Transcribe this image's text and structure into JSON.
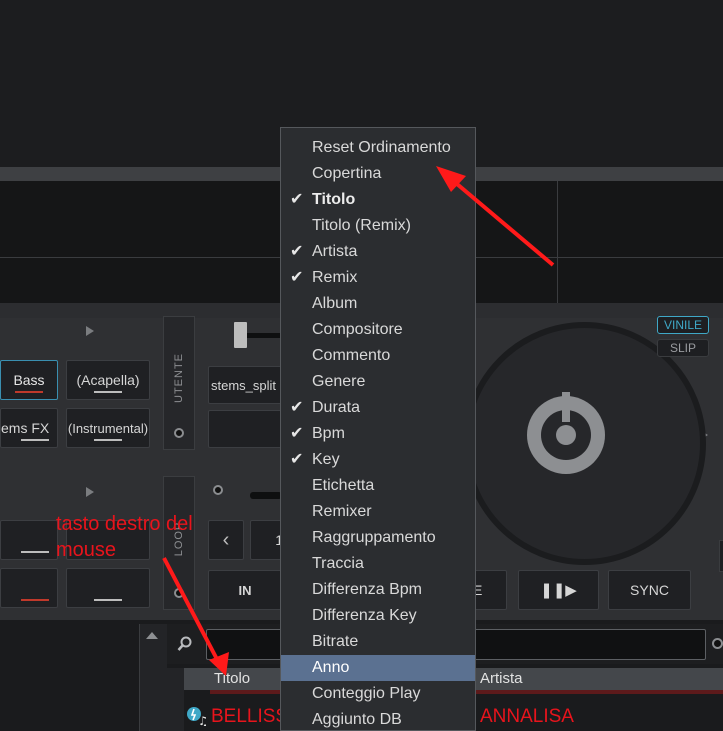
{
  "deck": {
    "pads_row1": [
      "Bass",
      "(Acapella)"
    ],
    "pads_row2": [
      "ems FX",
      "(Instrumental)"
    ],
    "user_label": "UTENTE",
    "loop_label": "LOOP",
    "stems_label": "stems_split",
    "vinyl_label": "VINILE",
    "slip_label": "SLIP",
    "in_label": "IN",
    "sync_label": "SYNC",
    "partial_digit": "1",
    "partial_letter": "E"
  },
  "context_menu": {
    "items": [
      {
        "label": "Reset Ordinamento",
        "checked": false
      },
      {
        "label": "Copertina",
        "checked": false
      },
      {
        "label": "Titolo",
        "checked": true,
        "bold": true
      },
      {
        "label": "Titolo (Remix)",
        "checked": false
      },
      {
        "label": "Artista",
        "checked": true
      },
      {
        "label": "Remix",
        "checked": true
      },
      {
        "label": "Album",
        "checked": false
      },
      {
        "label": "Compositore",
        "checked": false
      },
      {
        "label": "Commento",
        "checked": false
      },
      {
        "label": "Genere",
        "checked": false
      },
      {
        "label": "Durata",
        "checked": true
      },
      {
        "label": "Bpm",
        "checked": true
      },
      {
        "label": "Key",
        "checked": true
      },
      {
        "label": "Etichetta",
        "checked": false
      },
      {
        "label": "Remixer",
        "checked": false
      },
      {
        "label": "Raggruppamento",
        "checked": false
      },
      {
        "label": "Traccia",
        "checked": false
      },
      {
        "label": "Differenza Bpm",
        "checked": false
      },
      {
        "label": "Differenza Key",
        "checked": false
      },
      {
        "label": "Bitrate",
        "checked": false
      },
      {
        "label": "Anno",
        "checked": false,
        "highlighted": true
      },
      {
        "label": "Conteggio Play",
        "checked": false
      },
      {
        "label": "Aggiunto DB",
        "checked": false
      }
    ],
    "check_symbol": "✔"
  },
  "browser": {
    "columns": [
      "Titolo",
      "Artista"
    ],
    "row_title": "BELLISSI",
    "row_artist": "ANNALISA"
  },
  "annotation": {
    "line1": "tasto destro del",
    "line2": "mouse"
  },
  "colors": {
    "annotation_red": "#e8141c",
    "menu_highlight": "#5b7191",
    "vinyl_accent": "#3fa8c7"
  }
}
